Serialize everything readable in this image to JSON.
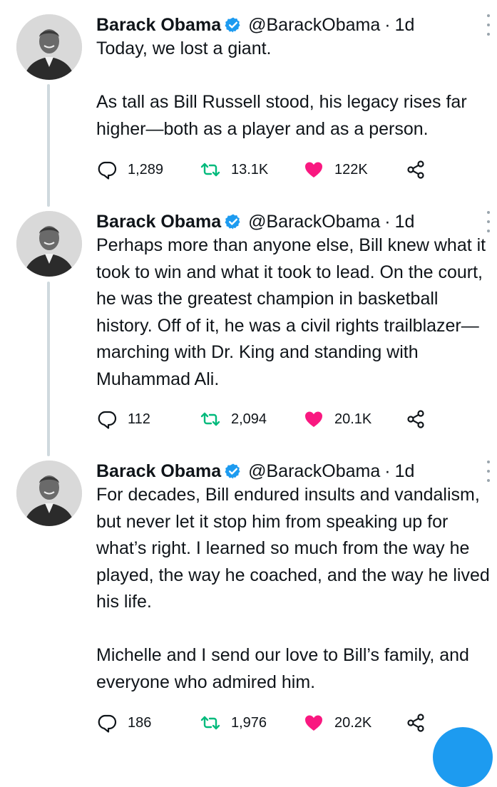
{
  "author": {
    "name": "Barack Obama",
    "handle": "@BarackObama",
    "separator": "·",
    "time": "1d"
  },
  "icons": {
    "verified": "verified-badge-icon",
    "reply": "reply-icon",
    "retweet": "retweet-icon",
    "like": "heart-icon",
    "share": "share-icon",
    "more": "more-options-icon"
  },
  "colors": {
    "verified": "#1d9bf0",
    "retweet": "#00ba7c",
    "like": "#f91880",
    "thread_line": "#cfd9de"
  },
  "tweets": [
    {
      "text": "Today, we lost a giant.\n\nAs tall as Bill Russell stood, his legacy rises far higher—both as a player and as a person.",
      "replies": "1,289",
      "retweets": "13.1K",
      "likes": "122K"
    },
    {
      "text": "Perhaps more than anyone else, Bill knew what it took to win and what it took to lead. On the court, he was the greatest champion in basketball history. Off of it, he was a civil rights trailblazer—marching with Dr. King and standing with Muhammad Ali.",
      "replies": "112",
      "retweets": "2,094",
      "likes": "20.1K"
    },
    {
      "text": "For decades, Bill endured insults and vandalism, but never let it stop him from speaking up for what’s right. I learned so much from the way he played, the way he coached, and the way he lived his life.\n\nMichelle and I send our love to Bill’s family, and everyone who admired him.",
      "replies": "186",
      "retweets": "1,976",
      "likes": "20.2K"
    }
  ]
}
